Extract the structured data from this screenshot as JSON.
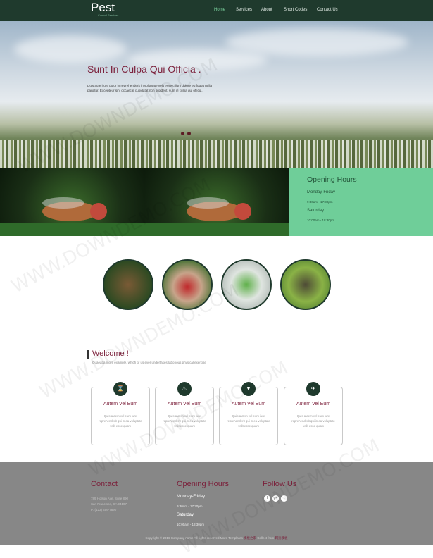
{
  "nav": {
    "logo": "Pest",
    "logo_sub": "Control Services",
    "items": [
      "Home",
      "Services",
      "About",
      "Short Codes",
      "Contact Us"
    ]
  },
  "hero": {
    "title": "Sunt In Culpa Qui Officia .",
    "text": "Duis aute irure dolor in reprehenderit in voluptate velit esse cillum dolore eu fugiat nulla pariatur. Excepteur sint occaecat cupidatat non proident, sunt in culpa qui officia."
  },
  "hours_box": {
    "title": "Opening Hours",
    "day1": "Monday-Friday",
    "time1": "9:30am - 17:30pm",
    "day2": "Saturday",
    "time2": "10:00am - 18:30pm"
  },
  "welcome": {
    "title": "Welcome !",
    "subtitle": "Quaeat a more example, which of us ever undertakes laborious physical exercise"
  },
  "cards": [
    {
      "title": "Autem Vel Eum",
      "text": "Quis autem vel eum iure reprehenderit qui in ea voluptate velit esse quam",
      "icon": "hourglass-icon"
    },
    {
      "title": "Autem Vel Eum",
      "text": "Quis autem vel eum iure reprehenderit qui in ea voluptate velit esse quam",
      "icon": "flame-icon"
    },
    {
      "title": "Autem Vel Eum",
      "text": "Quis autem vel eum iure reprehenderit qui in ea voluptate velit esse quam",
      "icon": "filter-icon"
    },
    {
      "title": "Autem Vel Eum",
      "text": "Quis autem vel eum iure reprehenderit qui in ea voluptate velit esse quam",
      "icon": "plane-icon"
    }
  ],
  "footer": {
    "contact_title": "Contact",
    "addr1": "789 Holson Ave, Suite 890",
    "addr2": "San Francisco, CA 94107",
    "addr3": "P: (123) 456-7890",
    "hours_title": "Opening Hours",
    "day1": "Monday-Friday",
    "time1": "9:30am - 17:30pm",
    "day2": "Saturday",
    "time2": "10:00am - 18:30pm",
    "follow_title": "Follow Us",
    "social": [
      "f",
      "g+",
      "t"
    ],
    "copyright_text": "Copyright © 2016 Company name All rights reserved",
    "more_templates": "More Templates",
    "link1": "模板之家",
    "collect_from": "Collect from",
    "link2": "网页模板"
  },
  "watermark": "WWW.DOWNDEMO.COM",
  "colors": {
    "nav_bg": "#1f3a2d",
    "accent_green": "#6fce99",
    "title_maroon": "#7b1f3a",
    "footer_bg": "#878787"
  }
}
